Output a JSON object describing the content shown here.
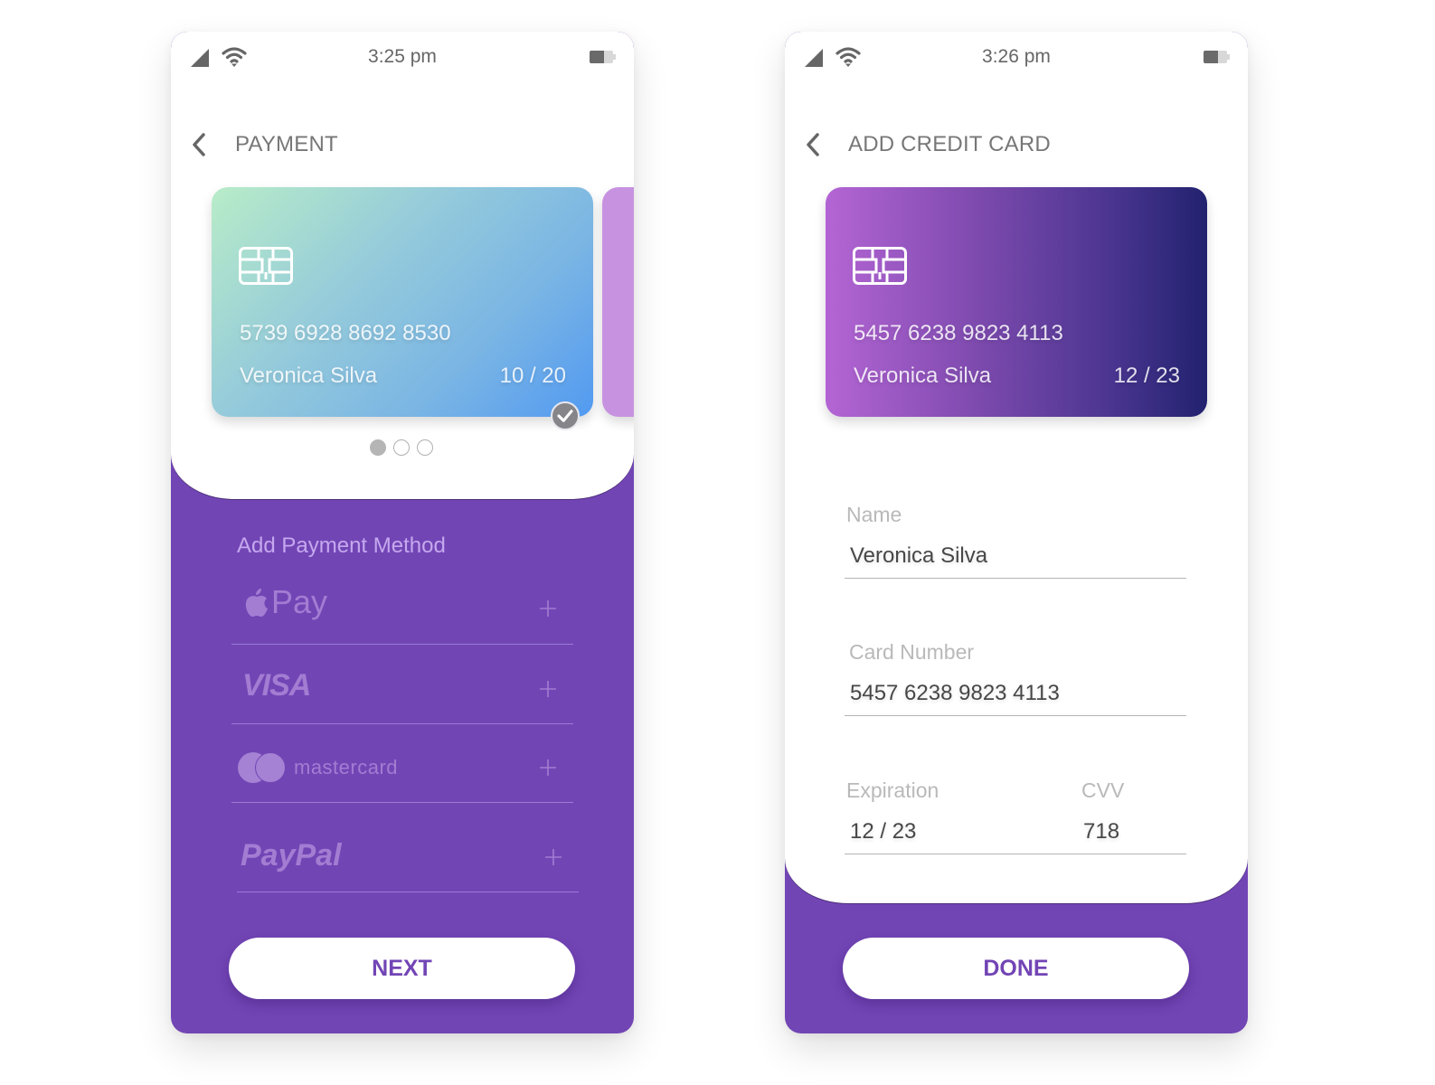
{
  "colors": {
    "brand_purple": "#7245b5",
    "muted_logo": "#a27dd2",
    "text_gray": "#777777"
  },
  "payment_screen": {
    "status_bar": {
      "time": "3:25 pm",
      "signal_icon": "signal-icon",
      "wifi_icon": "wifi-icon",
      "battery_icon": "battery-icon"
    },
    "header": {
      "back_icon": "chevron-left-icon",
      "title": "PAYMENT"
    },
    "cards": [
      {
        "number": "5739 6928 8692 8530",
        "holder": "Veronica Silva",
        "expiry": "10 / 20",
        "selected": true
      },
      {
        "number": "",
        "holder": "",
        "expiry": "",
        "selected": false
      }
    ],
    "pager": {
      "count": 3,
      "active_index": 0
    },
    "add_method_title": "Add Payment Method",
    "methods": [
      {
        "id": "applepay",
        "label": "Pay",
        "icon": "apple-icon",
        "action": "+"
      },
      {
        "id": "visa",
        "label": "VISA",
        "action": "+"
      },
      {
        "id": "mastercard",
        "label": "mastercard",
        "icon": "mastercard-circles-icon",
        "action": "+"
      },
      {
        "id": "paypal",
        "label": "PayPal",
        "action": "+"
      }
    ],
    "next_button": "NEXT"
  },
  "add_card_screen": {
    "status_bar": {
      "time": "3:26 pm",
      "signal_icon": "signal-icon",
      "wifi_icon": "wifi-icon",
      "battery_icon": "battery-icon"
    },
    "header": {
      "back_icon": "chevron-left-icon",
      "title": "ADD CREDIT CARD"
    },
    "card": {
      "number": "5457 6238 9823 4113",
      "holder": "Veronica Silva",
      "expiry": "12 / 23"
    },
    "form": {
      "name": {
        "label": "Name",
        "value": "Veronica Silva"
      },
      "card_number": {
        "label": "Card Number",
        "value": "5457 6238 9823 4113"
      },
      "expiration": {
        "label": "Expiration",
        "value": "12 / 23"
      },
      "cvv": {
        "label": "CVV",
        "value": "718"
      }
    },
    "done_button": "DONE"
  }
}
